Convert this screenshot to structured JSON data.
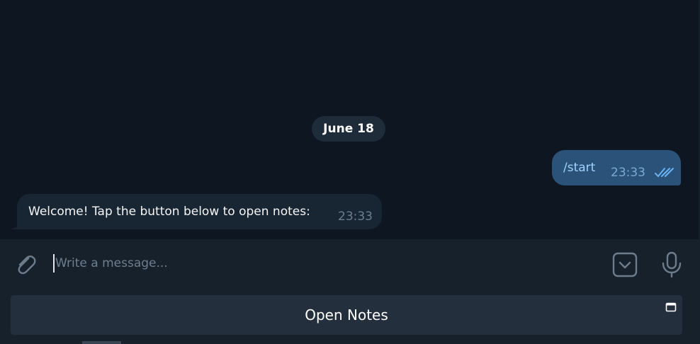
{
  "chat": {
    "date_separator": "June 18",
    "messages": [
      {
        "direction": "outgoing",
        "text": "/start",
        "time": "23:33",
        "status": "read"
      },
      {
        "direction": "incoming",
        "text": "Welcome! Tap the button below to open notes:",
        "time": "23:33"
      }
    ]
  },
  "composer": {
    "placeholder": "Write a message...",
    "value": ""
  },
  "webapp_button": {
    "label": "Open Notes"
  },
  "colors": {
    "background": "#0e1621",
    "panel": "#17212b",
    "outgoing_bubble": "#2b5278",
    "incoming_bubble": "#182533",
    "accent": "#6ab3f3"
  },
  "icons": {
    "attach": "paperclip-icon",
    "sticker": "sticker-icon",
    "voice": "microphone-icon",
    "read_status": "double-check-icon",
    "webapp": "window-icon"
  }
}
